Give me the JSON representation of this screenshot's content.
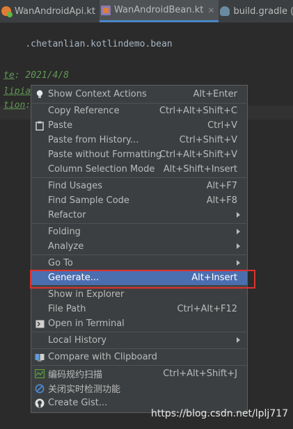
{
  "tabs": [
    {
      "label": "WanAndroidApi.kt",
      "icon": "kotlin-class-icon",
      "active": false
    },
    {
      "label": "WanAndroidBean.kt",
      "icon": "kotlin-file-icon",
      "active": true
    },
    {
      "label": "build.gradle (:",
      "icon": "gradle-icon",
      "active": false
    }
  ],
  "code": {
    "line1": ".chetanlian.kotlindemo.bean",
    "line2_tag": "te",
    "line2_rest": ": 2021/4/8",
    "line3": "lipiao",
    "line4_tag": "tion",
    "line4_rest": ":"
  },
  "menu": {
    "show_context_actions": {
      "label": "Show Context Actions",
      "shortcut": "Alt+Enter",
      "icon": "lightbulb-icon"
    },
    "copy_reference": {
      "label": "Copy Reference",
      "shortcut": "Ctrl+Alt+Shift+C"
    },
    "paste": {
      "label": "Paste",
      "shortcut": "Ctrl+V",
      "icon": "clipboard-icon"
    },
    "paste_from_history": {
      "label": "Paste from History...",
      "shortcut": "Ctrl+Shift+V"
    },
    "paste_without_formatting": {
      "label": "Paste without Formatting",
      "shortcut": "Ctrl+Alt+Shift+V"
    },
    "column_selection_mode": {
      "label": "Column Selection Mode",
      "shortcut": "Alt+Shift+Insert"
    },
    "find_usages": {
      "label": "Find Usages",
      "shortcut": "Alt+F7"
    },
    "find_sample_code": {
      "label": "Find Sample Code",
      "shortcut": "Alt+F8"
    },
    "refactor": {
      "label": "Refactor"
    },
    "folding": {
      "label": "Folding"
    },
    "analyze": {
      "label": "Analyze"
    },
    "go_to": {
      "label": "Go To"
    },
    "generate": {
      "label": "Generate...",
      "shortcut": "Alt+Insert"
    },
    "show_in_explorer": {
      "label": "Show in Explorer"
    },
    "file_path": {
      "label": "File Path",
      "shortcut": "Ctrl+Alt+F12"
    },
    "open_in_terminal": {
      "label": "Open in Terminal",
      "icon": "terminal-icon"
    },
    "local_history": {
      "label": "Local History"
    },
    "compare_with_clipboard": {
      "label": "Compare with Clipboard",
      "icon": "compare-icon"
    },
    "code_scan": {
      "label": "编码规约扫描",
      "shortcut": "Ctrl+Alt+Shift+J",
      "icon": "code-scan-icon"
    },
    "disable_realtime_check": {
      "label": "关闭实时检测功能",
      "icon": "disable-icon"
    },
    "create_gist": {
      "label": "Create Gist...",
      "icon": "github-icon"
    }
  },
  "watermark": "https://blog.csdn.net/lplj717",
  "colors": {
    "background": "#2b2b2b",
    "menu_background": "#3c3f41",
    "selection": "#4b6eaf",
    "highlight_box": "#e0312e",
    "doc_comment": "#629755"
  }
}
